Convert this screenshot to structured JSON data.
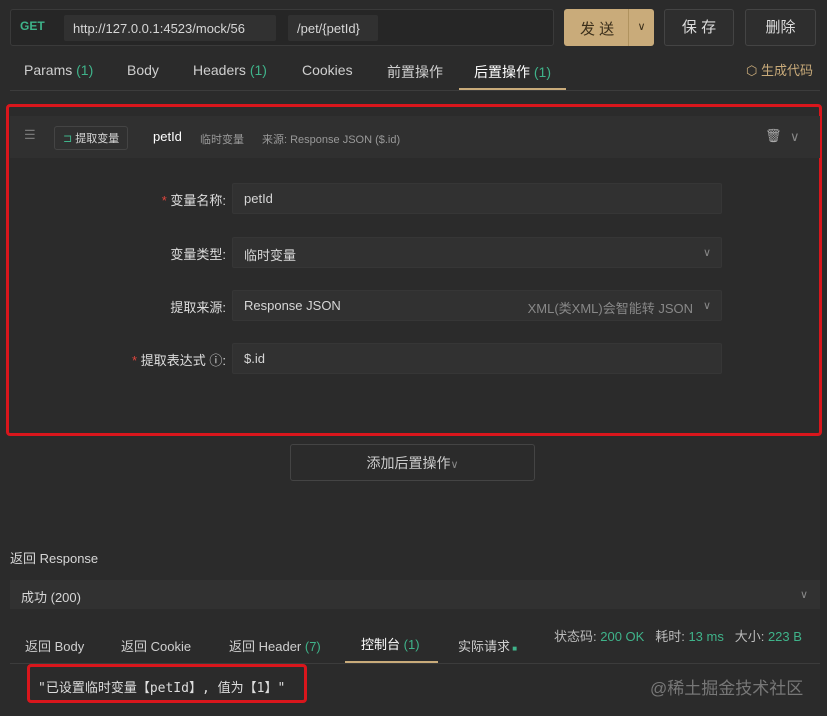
{
  "request": {
    "method": "GET",
    "host": "http://127.0.0.1:4523/mock/56",
    "path": "/pet/{petId}",
    "send": "发 送",
    "save": "保 存",
    "delete": "删除"
  },
  "tabs": [
    {
      "label": "Params",
      "count": "(1)"
    },
    {
      "label": "Body"
    },
    {
      "label": "Headers",
      "count": "(1)"
    },
    {
      "label": "Cookies"
    },
    {
      "label": "前置操作"
    },
    {
      "label": "后置操作",
      "count": "(1)"
    }
  ],
  "gen_code": "生成代码",
  "action": {
    "type": "提取变量",
    "name": "petId",
    "scope": "临时变量",
    "source": "来源: Response JSON ($.id)"
  },
  "form": {
    "var_name_label": "变量名称",
    "var_name": "petId",
    "var_type_label": "变量类型",
    "var_type": "临时变量",
    "source_label": "提取来源",
    "source": "Response JSON",
    "source_hint": "XML(类XML)会智能转 JSON",
    "expr_label": "提取表达式",
    "expr": "$.id"
  },
  "add_post": "添加后置操作",
  "response": {
    "title": "返回 Response",
    "status_select": "成功 (200)",
    "tabs": [
      {
        "label": "返回 Body"
      },
      {
        "label": "返回 Cookie"
      },
      {
        "label": "返回 Header",
        "count": "(7)"
      },
      {
        "label": "控制台",
        "count": "(1)"
      },
      {
        "label": "实际请求"
      }
    ],
    "status_label": "状态码:",
    "status": "200 OK",
    "time_label": "耗时:",
    "time": "13 ms",
    "size_label": "大小:",
    "size": "223 B",
    "console": "\"已设置临时变量【petId】, 值为【1】\""
  },
  "watermark": "@稀土掘金技术社区"
}
